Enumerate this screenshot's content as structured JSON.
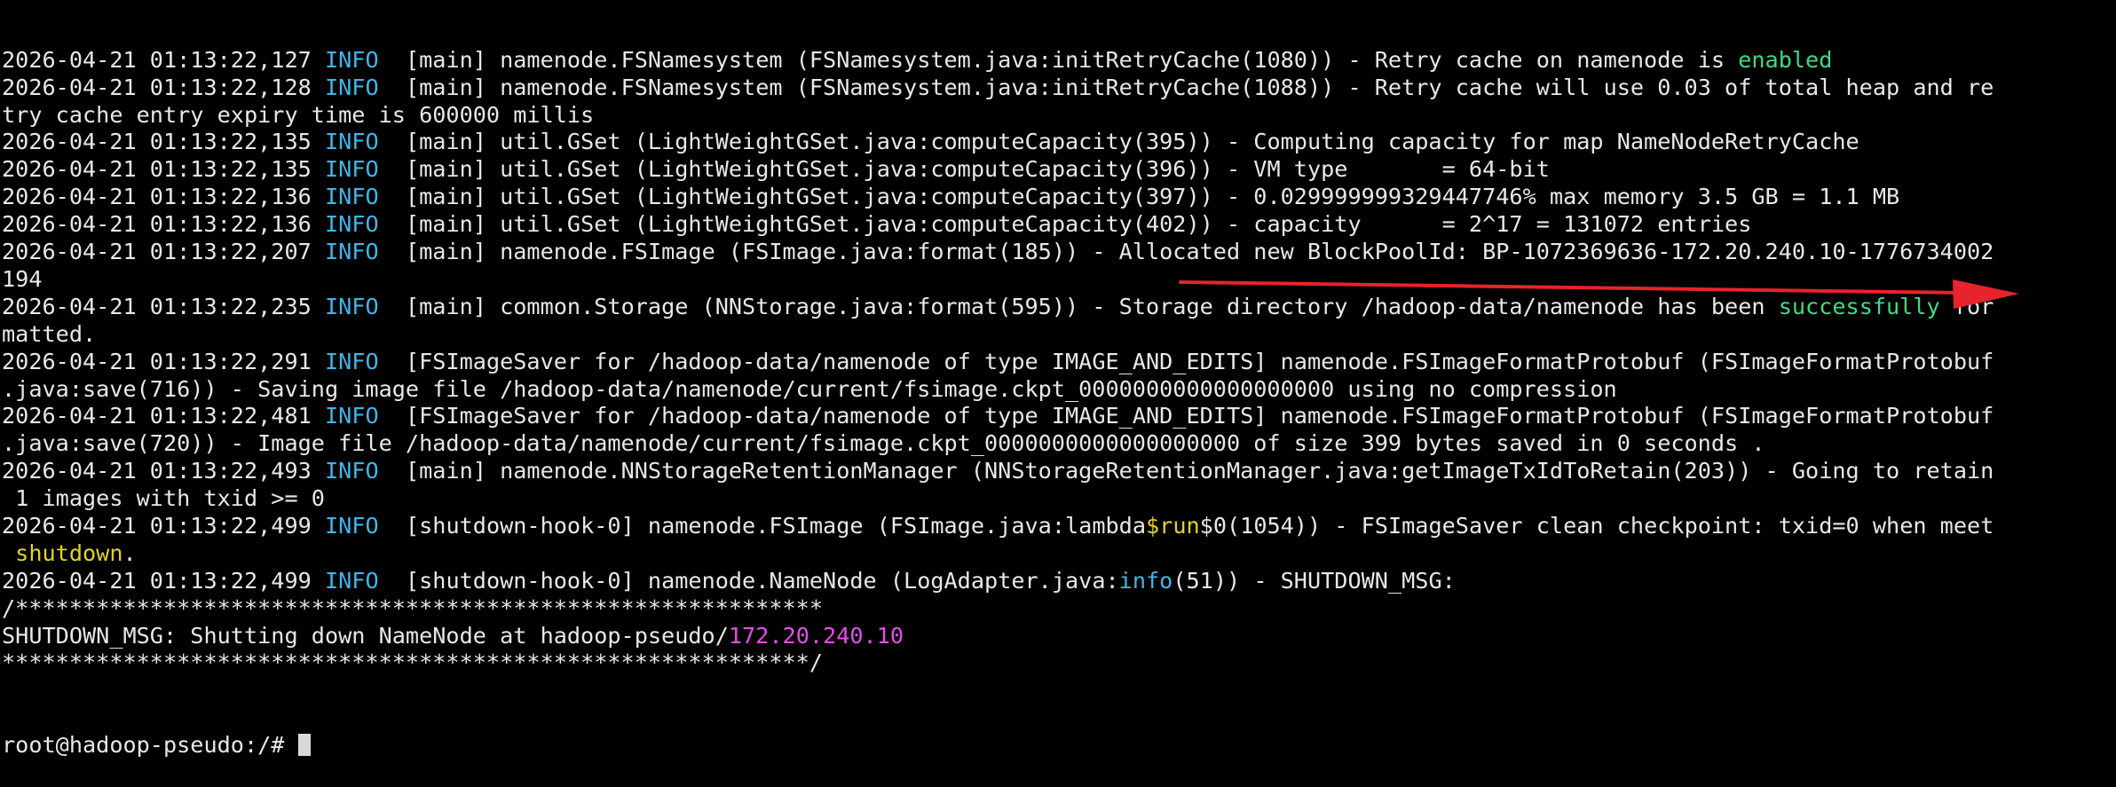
{
  "terminal": {
    "lines": [
      [
        {
          "t": "2026-04-21 01:13:22,127 "
        },
        {
          "t": "INFO",
          "c": "info"
        },
        {
          "t": "  [main] namenode.FSNamesystem (FSNamesystem.java:initRetryCache(1080)) - Retry cache on namenode is "
        },
        {
          "t": "enabled",
          "c": "green"
        }
      ],
      [
        {
          "t": "2026-04-21 01:13:22,128 "
        },
        {
          "t": "INFO",
          "c": "info"
        },
        {
          "t": "  [main] namenode.FSNamesystem (FSNamesystem.java:initRetryCache(1088)) - Retry cache will use 0.03 of total heap and re"
        }
      ],
      [
        {
          "t": "try cache entry expiry time is 600000 millis"
        }
      ],
      [
        {
          "t": "2026-04-21 01:13:22,135 "
        },
        {
          "t": "INFO",
          "c": "info"
        },
        {
          "t": "  [main] util.GSet (LightWeightGSet.java:computeCapacity(395)) - Computing capacity for map NameNodeRetryCache"
        }
      ],
      [
        {
          "t": "2026-04-21 01:13:22,135 "
        },
        {
          "t": "INFO",
          "c": "info"
        },
        {
          "t": "  [main] util.GSet (LightWeightGSet.java:computeCapacity(396)) - VM type       = 64-bit"
        }
      ],
      [
        {
          "t": "2026-04-21 01:13:22,136 "
        },
        {
          "t": "INFO",
          "c": "info"
        },
        {
          "t": "  [main] util.GSet (LightWeightGSet.java:computeCapacity(397)) - 0.029999999329447746% max memory 3.5 GB = 1.1 MB"
        }
      ],
      [
        {
          "t": "2026-04-21 01:13:22,136 "
        },
        {
          "t": "INFO",
          "c": "info"
        },
        {
          "t": "  [main] util.GSet (LightWeightGSet.java:computeCapacity(402)) - capacity      = 2^17 = 131072 entries"
        }
      ],
      [
        {
          "t": "2026-04-21 01:13:22,207 "
        },
        {
          "t": "INFO",
          "c": "info"
        },
        {
          "t": "  [main] namenode.FSImage (FSImage.java:format(185)) - Allocated new BlockPoolId: BP-1072369636-172.20.240.10-1776734002"
        }
      ],
      [
        {
          "t": "194"
        }
      ],
      [
        {
          "t": "2026-04-21 01:13:22,235 "
        },
        {
          "t": "INFO",
          "c": "info"
        },
        {
          "t": "  [main] common.Storage (NNStorage.java:format(595)) - Storage directory /hadoop-data/namenode has been "
        },
        {
          "t": "successfully",
          "c": "green"
        },
        {
          "t": " for"
        }
      ],
      [
        {
          "t": "matted."
        }
      ],
      [
        {
          "t": "2026-04-21 01:13:22,291 "
        },
        {
          "t": "INFO",
          "c": "info"
        },
        {
          "t": "  [FSImageSaver for /hadoop-data/namenode of type IMAGE_AND_EDITS] namenode.FSImageFormatProtobuf (FSImageFormatProtobuf"
        }
      ],
      [
        {
          "t": ".java:save(716)) - Saving image file /hadoop-data/namenode/current/fsimage.ckpt_0000000000000000000 using no compression"
        }
      ],
      [
        {
          "t": "2026-04-21 01:13:22,481 "
        },
        {
          "t": "INFO",
          "c": "info"
        },
        {
          "t": "  [FSImageSaver for /hadoop-data/namenode of type IMAGE_AND_EDITS] namenode.FSImageFormatProtobuf (FSImageFormatProtobuf"
        }
      ],
      [
        {
          "t": ".java:save(720)) - Image file /hadoop-data/namenode/current/fsimage.ckpt_0000000000000000000 of size 399 bytes saved in 0 seconds ."
        }
      ],
      [
        {
          "t": "2026-04-21 01:13:22,493 "
        },
        {
          "t": "INFO",
          "c": "info"
        },
        {
          "t": "  [main] namenode.NNStorageRetentionManager (NNStorageRetentionManager.java:getImageTxIdToRetain(203)) - Going to retain"
        }
      ],
      [
        {
          "t": " 1 images with txid >= 0"
        }
      ],
      [
        {
          "t": "2026-04-21 01:13:22,499 "
        },
        {
          "t": "INFO",
          "c": "info"
        },
        {
          "t": "  [shutdown-hook-0] namenode.FSImage (FSImage.java:lambda"
        },
        {
          "t": "$run",
          "c": "yellow"
        },
        {
          "t": "$0(1054)) - FSImageSaver clean checkpoint: txid=0 when meet"
        }
      ],
      [
        {
          "t": " "
        },
        {
          "t": "shutdown",
          "c": "yellow"
        },
        {
          "t": "."
        }
      ],
      [
        {
          "t": "2026-04-21 01:13:22,499 "
        },
        {
          "t": "INFO",
          "c": "info"
        },
        {
          "t": "  [shutdown-hook-0] namenode.NameNode (LogAdapter.java:"
        },
        {
          "t": "info",
          "c": "cyan"
        },
        {
          "t": "(51)) - SHUTDOWN_MSG:"
        }
      ],
      [
        {
          "t": "/************************************************************"
        }
      ],
      [
        {
          "t": "SHUTDOWN_MSG: Shutting down NameNode at hadoop-pseudo/"
        },
        {
          "t": "172.20.240.10",
          "c": "magenta"
        }
      ],
      [
        {
          "t": "************************************************************/"
        }
      ]
    ],
    "prompt": "root@hadoop-pseudo:/# "
  },
  "colors": {
    "background": "#000000",
    "foreground": "#e8e8e8",
    "info": "#3fb6e8",
    "success": "#3ddc84",
    "keyword": "#e3d12b",
    "ip": "#e44ee8",
    "arrow": "#e8232b"
  }
}
